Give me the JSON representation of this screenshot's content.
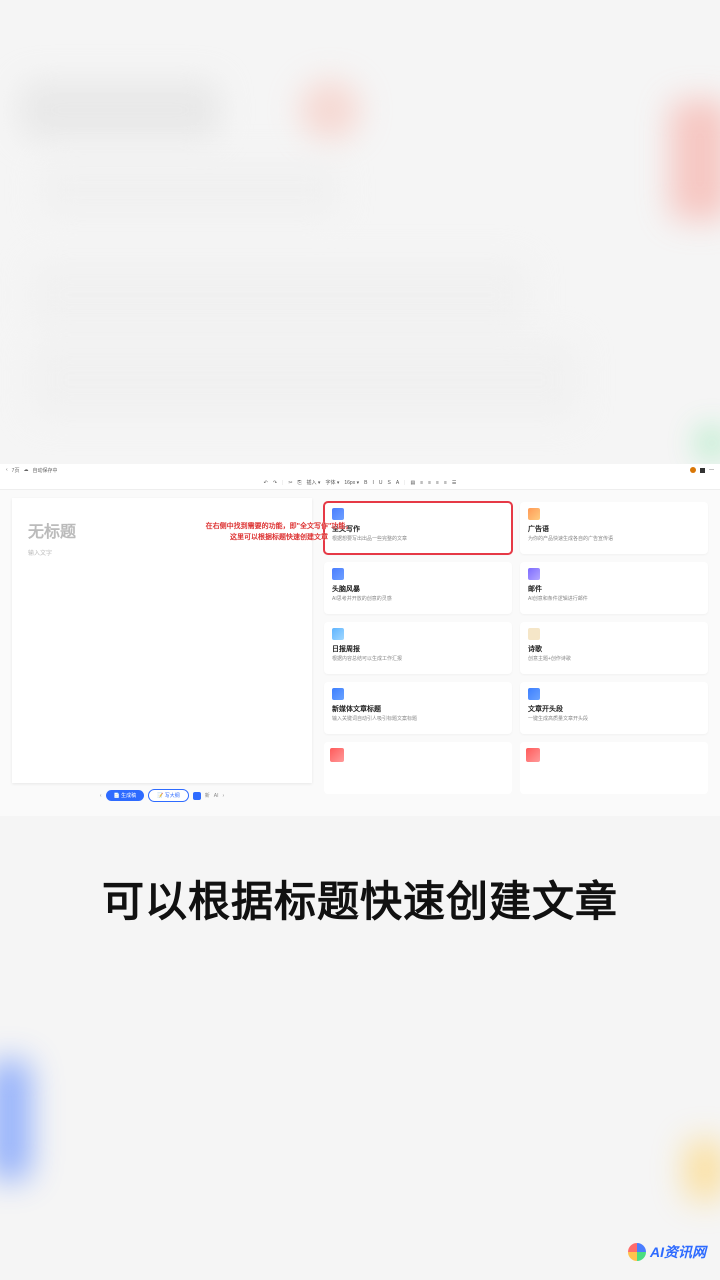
{
  "topbar": {
    "status_icon_label": "自动保存中",
    "doc_count": "7页"
  },
  "toolbar": {
    "items": [
      "↶",
      "↷",
      "✂",
      "⎘",
      "插入 ▾",
      "字体 ▾",
      "16px ▾",
      "B",
      "I",
      "U",
      "S",
      "A",
      "▤",
      "≡",
      "≡",
      "≡",
      "≡",
      "☰"
    ]
  },
  "document": {
    "title_placeholder": "无标题",
    "body_placeholder": "输入文字",
    "bottom": {
      "btn1": "📄 生成稿",
      "btn2": "📝 写大纲",
      "label_short": "新"
    }
  },
  "annotation": {
    "line1": "在右侧中找到需要的功能，即\"全文写作\"功能，",
    "line2": "这里可以根据标题快速创建文章"
  },
  "cards": [
    {
      "title": "全文写作",
      "desc": "根据想要写出出品一些完整的文章",
      "icon": "ic-blue",
      "highlight": true
    },
    {
      "title": "广告语",
      "desc": "为你的产品快速生成各自的广告宣传语",
      "icon": "ic-orange"
    },
    {
      "title": "头脑风暴",
      "desc": "AI思考并开放的创意的灵感",
      "icon": "ic-blue"
    },
    {
      "title": "邮件",
      "desc": "AI创意和条件逻辑进行邮件",
      "icon": "ic-purple"
    },
    {
      "title": "日报周报",
      "desc": "根据内容总结可以生成工作汇报",
      "icon": "ic-lblue"
    },
    {
      "title": "诗歌",
      "desc": "创意主题+创作诗歌",
      "icon": "ic-sand"
    },
    {
      "title": "新媒体文章标题",
      "desc": "输入关键词自动引人吸引标题文案标题",
      "icon": "ic-bluel"
    },
    {
      "title": "文章开头段",
      "desc": "一键生成高质量文章开头段",
      "icon": "ic-bluel"
    }
  ],
  "caption": "可以根据标题快速创建文章",
  "watermark": "AI资讯网"
}
